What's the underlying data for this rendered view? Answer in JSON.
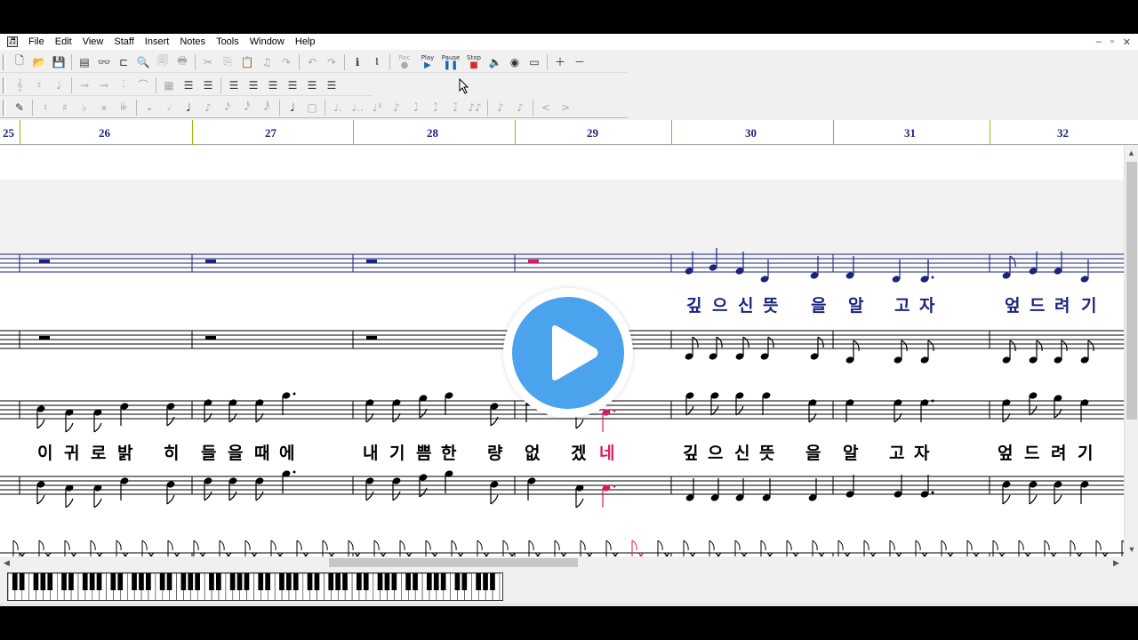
{
  "menubar": {
    "items": [
      "File",
      "Edit",
      "View",
      "Staff",
      "Insert",
      "Notes",
      "Tools",
      "Window",
      "Help"
    ],
    "window_controls": [
      "–",
      "▫",
      "✕"
    ]
  },
  "toolbar": {
    "play_label": "Play",
    "pause_label": "Pause",
    "stop_label": "Stop",
    "rec_label": "Rec"
  },
  "ruler": {
    "measures": [
      "25",
      "26",
      "27",
      "28",
      "29",
      "30",
      "31",
      "32"
    ]
  },
  "lyrics": {
    "staff1_line": [
      {
        "text": "깊",
        "color": "blue"
      },
      {
        "text": "으",
        "color": "blue"
      },
      {
        "text": "신",
        "color": "blue"
      },
      {
        "text": "뜻",
        "color": "blue"
      },
      {
        "text": "을",
        "color": "blue"
      },
      {
        "text": "알",
        "color": "blue"
      },
      {
        "text": "고",
        "color": "blue"
      },
      {
        "text": "자",
        "color": "blue"
      },
      {
        "text": "엎",
        "color": "blue"
      },
      {
        "text": "드",
        "color": "blue"
      },
      {
        "text": "려",
        "color": "blue"
      },
      {
        "text": "기",
        "color": "blue"
      }
    ],
    "staff3_line": [
      {
        "text": "이",
        "color": "black"
      },
      {
        "text": "귀",
        "color": "black"
      },
      {
        "text": "로",
        "color": "black"
      },
      {
        "text": "밝",
        "color": "black"
      },
      {
        "text": "히",
        "color": "black"
      },
      {
        "text": "들",
        "color": "black"
      },
      {
        "text": "을",
        "color": "black"
      },
      {
        "text": "때",
        "color": "black"
      },
      {
        "text": "에",
        "color": "black"
      },
      {
        "text": "내",
        "color": "black"
      },
      {
        "text": "기",
        "color": "black"
      },
      {
        "text": "쁨",
        "color": "black"
      },
      {
        "text": "한",
        "color": "black"
      },
      {
        "text": "량",
        "color": "black"
      },
      {
        "text": "없",
        "color": "black"
      },
      {
        "text": "겠",
        "color": "black"
      },
      {
        "text": "네",
        "color": "red"
      },
      {
        "text": "깊",
        "color": "black"
      },
      {
        "text": "으",
        "color": "black"
      },
      {
        "text": "신",
        "color": "black"
      },
      {
        "text": "뜻",
        "color": "black"
      },
      {
        "text": "을",
        "color": "black"
      },
      {
        "text": "알",
        "color": "black"
      },
      {
        "text": "고",
        "color": "black"
      },
      {
        "text": "자",
        "color": "black"
      },
      {
        "text": "엎",
        "color": "black"
      },
      {
        "text": "드",
        "color": "black"
      },
      {
        "text": "려",
        "color": "black"
      },
      {
        "text": "기",
        "color": "black"
      }
    ]
  },
  "colors": {
    "staff1": "#1a237e",
    "highlight": "#d81b60",
    "measure_tick": "#a5b300",
    "play_button": "#4aa3ec"
  },
  "overlay": {
    "icon": "play-icon"
  }
}
